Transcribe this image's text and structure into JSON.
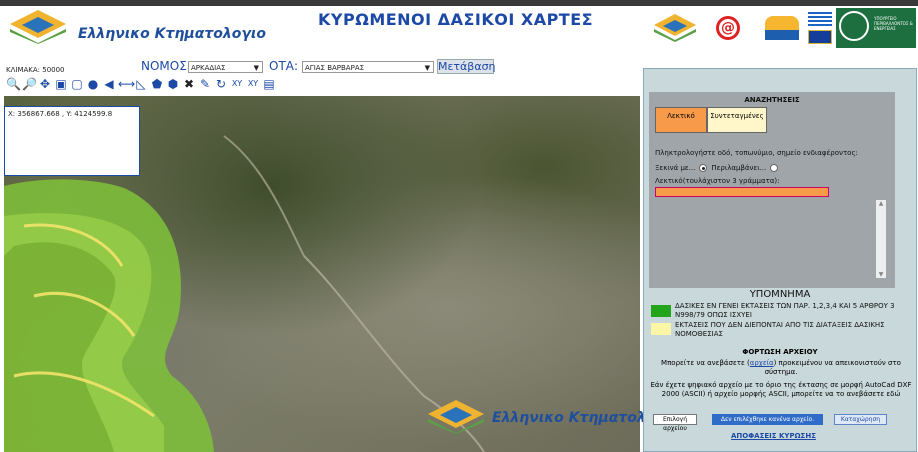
{
  "header": {
    "logo_text": "Ελληνικο Κτηματολογιο",
    "title": "ΚΥΡΩΜΕΝΟΙ ΔΑΣΙΚΟΙ ΧΑΡΤΕΣ",
    "partner_ministry": "ΥΠΟΥΡΓΕΙΟ ΠΕΡΙΒΑΛΛΟΝΤΟΣ & ΕΝΕΡΓΕΙΑΣ"
  },
  "controls": {
    "scale_label": "ΚΛΙΜΑΚΑ: 50000",
    "nomos_label": "ΝΟΜΟΣ:",
    "nomos_value": "ΑΡΚΑΔΙΑΣ",
    "ota_label": "ΟΤΑ:",
    "ota_value": "ΑΓΙΑΣ ΒΑΡΒΑΡΑΣ",
    "goto_button": "Μετάβαση"
  },
  "toolbar": {
    "tools": [
      "zoom-in-icon",
      "zoom-out-icon",
      "pan-icon",
      "zoom-box-icon",
      "zoom-extent-icon",
      "identify-icon",
      "back-icon",
      "measure-distance-icon",
      "measure-area-icon",
      "polygon-icon",
      "plot-icon",
      "clear-icon",
      "edit-icon",
      "refresh-icon",
      "xy-icon",
      "xy-search-icon",
      "print-icon"
    ]
  },
  "map": {
    "coordinates": "X: 356867.668 , Y: 4124599.8",
    "watermark_text": "Ελληνικο Κτηματολογιο"
  },
  "search": {
    "title": "ΑΝΑΖΗΤΗΣΕΙΣ",
    "tab_text": "Λεκτικό",
    "tab_coords": "Συντεταγμένες",
    "description": "Πληκτρολογήστε οδό, τοπωνύμιο, σημείο ενδιαφέροντος:",
    "radio_starts": "Ξεκινά με...",
    "radio_contains": "Περιλαμβάνει...",
    "input_label": "Λεκτικό(τουλάχιστον 3 γράμματα):"
  },
  "legend": {
    "title": "ΥΠΟΜΝΗΜΑ",
    "item1": "ΔΑΣΙΚΕΣ ΕΝ ΓΕΝΕΙ ΕΚΤΑΣΕΙΣ ΤΩΝ ΠΑΡ. 1,2,3,4 ΚΑΙ 5 ΑΡΘΡΟΥ 3 Ν998/79 ΟΠΩΣ ΙΣΧΥΕΙ",
    "item2": "ΕΚΤΑΣΕΙΣ ΠΟΥ ΔΕΝ ΔΙΕΠΟΝΤΑΙ ΑΠΟ ΤΙΣ ΔΙΑΤΑΞΕΙΣ ΔΑΣΙΚΗΣ ΝΟΜΟΘΕΣΙΑΣ",
    "color1": "#22a51a",
    "color2": "#fbf6a6"
  },
  "upload": {
    "title": "ΦΟΡΤΩΣΗ ΑΡΧΕΙΟΥ",
    "line1a": "Μπορείτε να ανεβάσετε (",
    "line1_link": "αρχεία",
    "line1b": ") προκειμένου να απεικονιστούν στο σύστημα.",
    "line2": "Εάν έχετε ψηφιακό αρχείο με το όριο της έκτασης σε μορφή AutoCad DXF 2000 (ASCII) ή αρχείο μορφής ASCII, μπορείτε να το ανεβάσετε εδώ",
    "choose_button": "Επιλογή αρχείου",
    "no_file": "Δεν επιλέχθηκε κανένα αρχείο.",
    "submit_button": "Καταχώρηση",
    "decisions_link": "ΑΠΟΦΑΣΕΙΣ ΚΥΡΩΣΗΣ"
  }
}
